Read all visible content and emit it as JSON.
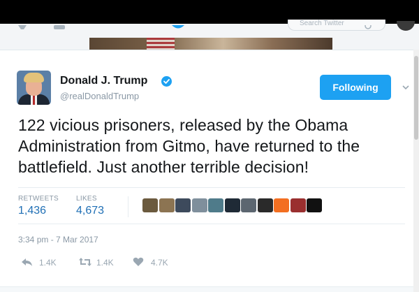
{
  "header": {
    "search_placeholder": "Search Twitter"
  },
  "tweet": {
    "author_name": "Donald J. Trump",
    "author_handle": "@realDonaldTrump",
    "follow_label": "Following",
    "text": "122 vicious prisoners, released by the Obama Administration from Gitmo, have returned to the battlefield. Just another terrible decision!",
    "timestamp": "3:34 pm - 7 Mar 2017"
  },
  "stats": {
    "retweets_label": "RETWEETS",
    "retweets_value": "1,436",
    "likes_label": "LIKES",
    "likes_value": "4,673"
  },
  "actions": {
    "reply_count": "1.4K",
    "retweet_count": "1.4K",
    "like_count": "4.7K"
  },
  "colors": {
    "follow_button": "#1da1f2",
    "stat_value": "#1f6fb5",
    "meta_text": "#8a98a5"
  },
  "icons": [
    "bird-icon",
    "home-icon",
    "notifications-icon",
    "search-icon",
    "verified-badge-icon",
    "chevron-down-icon",
    "reply-icon",
    "retweet-icon",
    "heart-icon"
  ],
  "likers": [
    {
      "name": "liker-avatar-1",
      "color": "#6b5a3e"
    },
    {
      "name": "liker-avatar-2",
      "color": "#8c7452"
    },
    {
      "name": "liker-avatar-3",
      "color": "#3d4a5c"
    },
    {
      "name": "liker-avatar-4",
      "color": "#7f8f9c"
    },
    {
      "name": "liker-avatar-5",
      "color": "#4f7b8a"
    },
    {
      "name": "liker-avatar-6",
      "color": "#1f2a36"
    },
    {
      "name": "liker-avatar-7",
      "color": "#5c6670"
    },
    {
      "name": "liker-avatar-8",
      "color": "#2a2a2a"
    },
    {
      "name": "liker-avatar-9",
      "color": "#f36f21"
    },
    {
      "name": "liker-avatar-10",
      "color": "#9a2f2f"
    },
    {
      "name": "liker-avatar-11",
      "color": "#111111"
    }
  ]
}
